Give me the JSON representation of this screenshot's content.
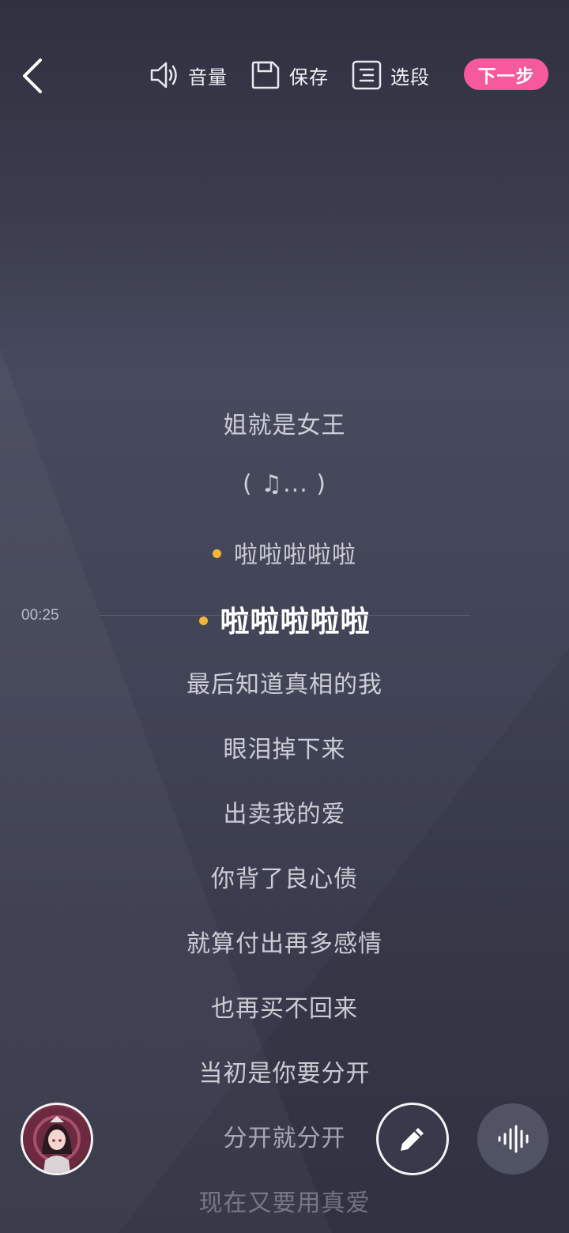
{
  "toolbar": {
    "back_icon": "chevron-left-icon",
    "volume": {
      "icon": "speaker-icon",
      "label": "音量"
    },
    "save": {
      "icon": "floppy-disk-icon",
      "label": "保存"
    },
    "segment": {
      "icon": "segment-list-icon",
      "label": "选段"
    },
    "next_label": "下一步",
    "next_color": "#f65a9c"
  },
  "player": {
    "current_time": "00:25",
    "highlight_dot_color": "#f3b63a"
  },
  "lyrics": [
    {
      "text": "姐就是女王",
      "state": "normal",
      "dot": false
    },
    {
      "text": "( ♫... )",
      "state": "normal",
      "dot": false
    },
    {
      "text": "啦啦啦啦啦",
      "state": "normal",
      "dot": true
    },
    {
      "text": "啦啦啦啦啦",
      "state": "current",
      "dot": true
    },
    {
      "text": "最后知道真相的我",
      "state": "normal",
      "dot": false
    },
    {
      "text": "眼泪掉下来",
      "state": "normal",
      "dot": false
    },
    {
      "text": "出卖我的爱",
      "state": "normal",
      "dot": false
    },
    {
      "text": "你背了良心债",
      "state": "normal",
      "dot": false
    },
    {
      "text": "就算付出再多感情",
      "state": "normal",
      "dot": false
    },
    {
      "text": "也再买不回来",
      "state": "normal",
      "dot": false
    },
    {
      "text": "当初是你要分开",
      "state": "normal",
      "dot": false
    },
    {
      "text": "分开就分开",
      "state": "fade1",
      "dot": false
    },
    {
      "text": "现在又要用真爱",
      "state": "fade2",
      "dot": false
    }
  ],
  "bottom": {
    "album_icon": "album-cover",
    "edit_icon": "pencil-icon",
    "voice_icon": "sound-wave-icon"
  }
}
